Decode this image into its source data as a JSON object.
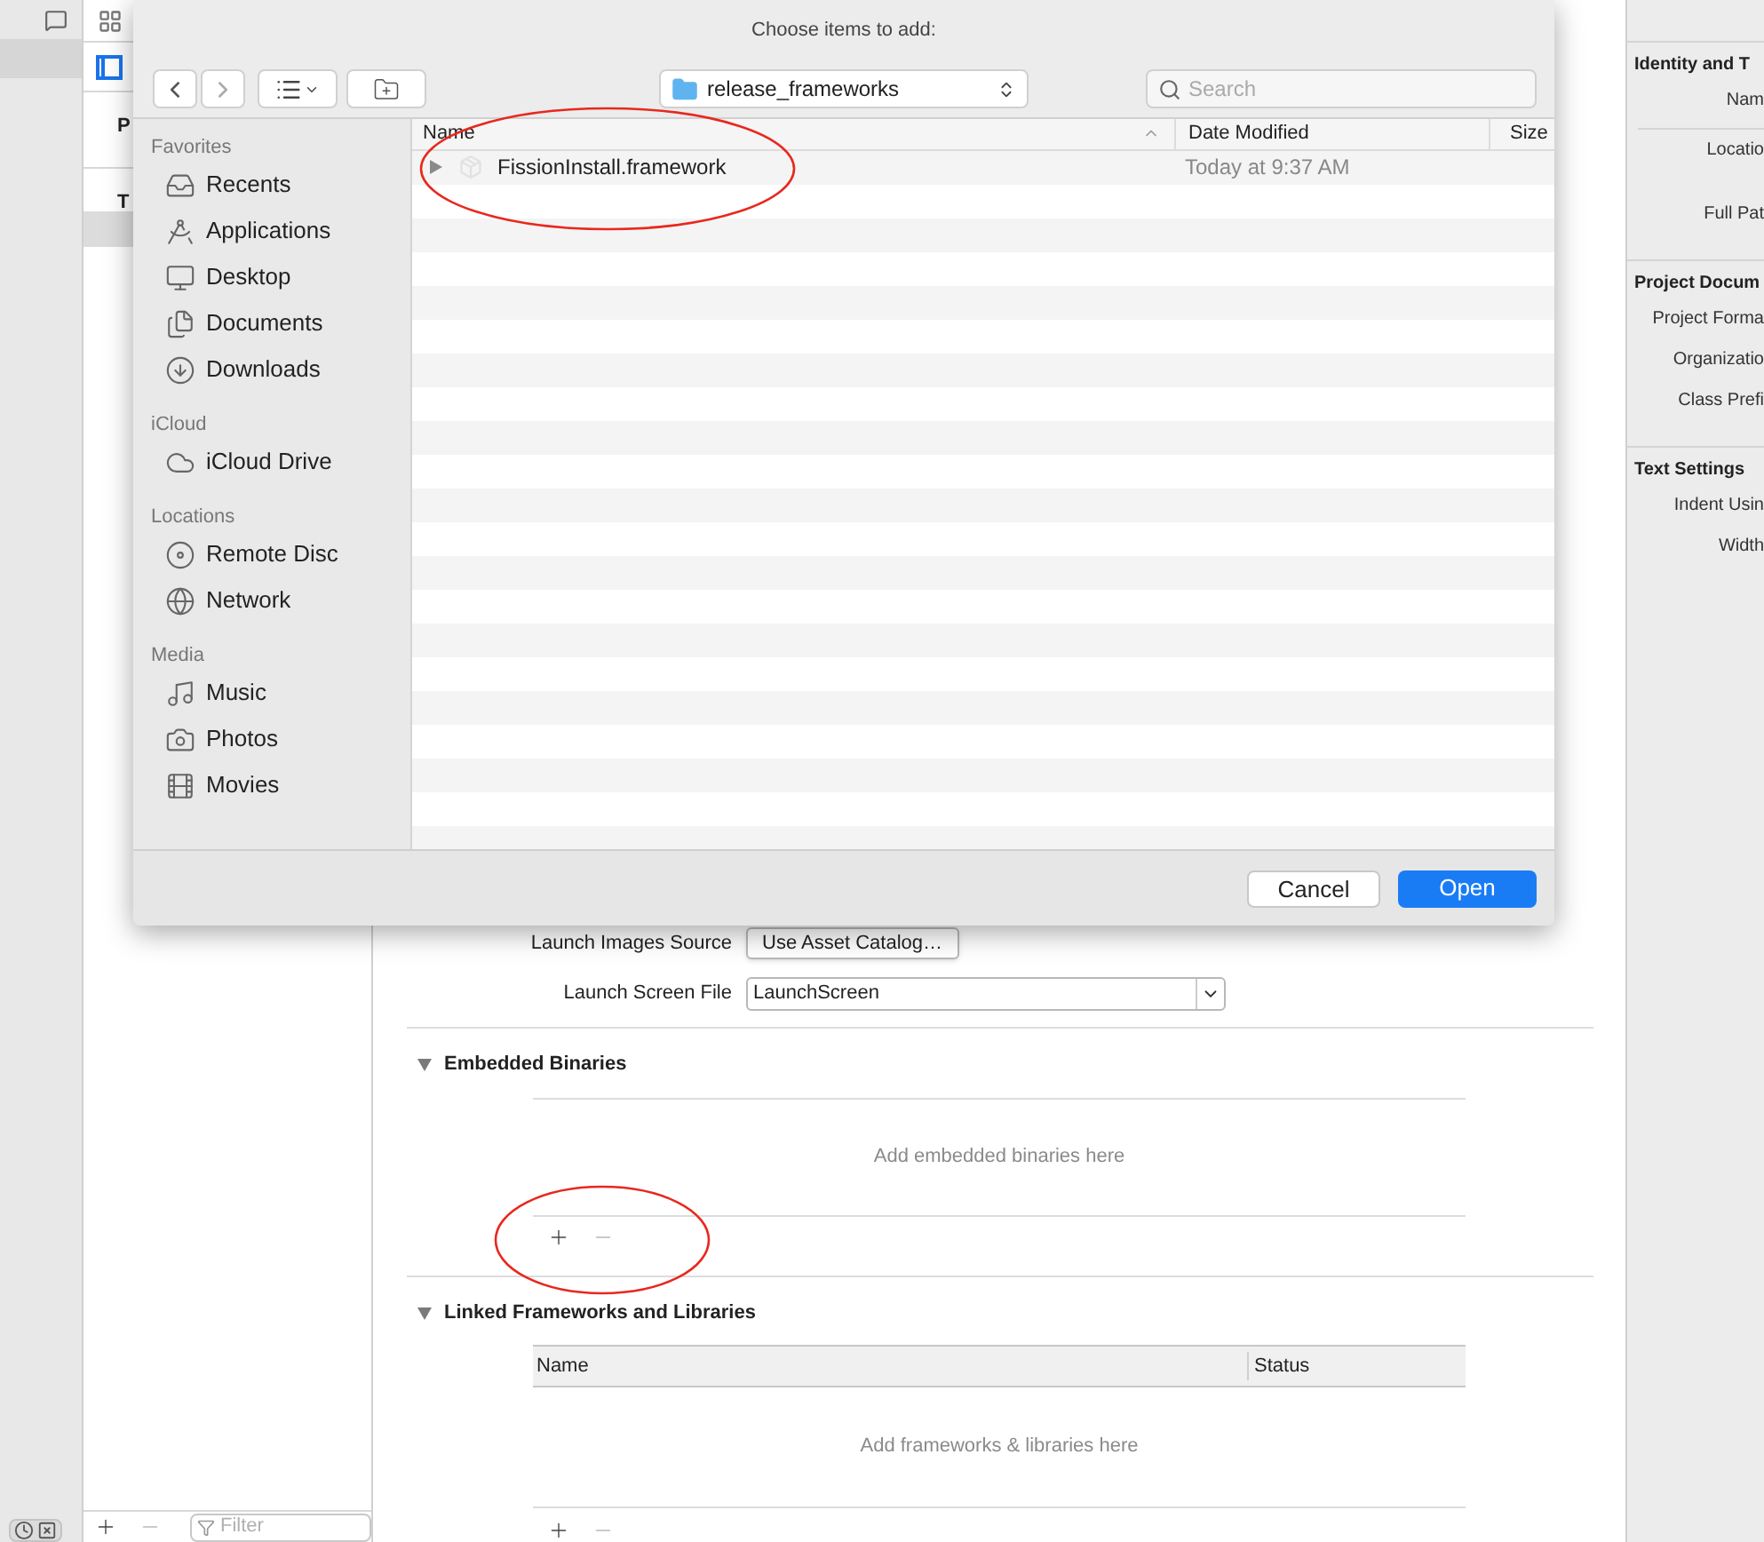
{
  "navigator": {
    "filter_placeholder": "Filter"
  },
  "project_list": {
    "sections": [
      {
        "heading": "P"
      },
      {
        "heading": "T",
        "rows": [
          {
            "selected": true
          }
        ]
      }
    ]
  },
  "dialog": {
    "title": "Choose items to add:",
    "path": "release_frameworks",
    "search": {
      "placeholder": "Search"
    },
    "sidebar": [
      {
        "heading": "Favorites",
        "items": [
          "Recents",
          "Applications",
          "Desktop",
          "Documents",
          "Downloads"
        ]
      },
      {
        "heading": "iCloud",
        "items": [
          "iCloud Drive"
        ]
      },
      {
        "heading": "Locations",
        "items": [
          "Remote Disc",
          "Network"
        ]
      },
      {
        "heading": "Media",
        "items": [
          "Music",
          "Photos",
          "Movies"
        ]
      }
    ],
    "columns": [
      {
        "label": "Name",
        "sorted": true
      },
      {
        "label": "Date Modified",
        "sorted": false
      },
      {
        "label": "Size",
        "sorted": false
      }
    ],
    "files": [
      {
        "name": "FissionInstall.framework",
        "date": "Today at 9:37 AM",
        "expanded": false
      }
    ],
    "buttons": [
      {
        "label": "Cancel",
        "default": false
      },
      {
        "label": "Open",
        "default": true
      }
    ]
  },
  "general": {
    "launch_images_source": {
      "label": "Launch Images Source",
      "button": "Use Asset Catalog…"
    },
    "launch_screen_file": {
      "label": "Launch Screen File",
      "value": "LaunchScreen"
    },
    "sections": [
      {
        "title": "Embedded Binaries",
        "expanded": true,
        "empty_text": "Add embedded binaries here"
      },
      {
        "title": "Linked Frameworks and Libraries",
        "expanded": true,
        "columns": [
          "Name",
          "Status"
        ],
        "empty_text": "Add frameworks & libraries here"
      }
    ]
  },
  "inspector": {
    "sections": [
      {
        "title": "Identity and T",
        "labels": [
          "Nam",
          "Locatio",
          "Full Pat"
        ]
      },
      {
        "title": "Project Docum",
        "labels": [
          "Project Forma",
          "Organizatio",
          "Class Prefi"
        ]
      },
      {
        "title": "Text Settings",
        "labels": [
          "Indent Usin",
          "Width"
        ]
      }
    ]
  },
  "annotations": [
    {
      "kind": "ellipse"
    },
    {
      "kind": "ellipse"
    }
  ]
}
